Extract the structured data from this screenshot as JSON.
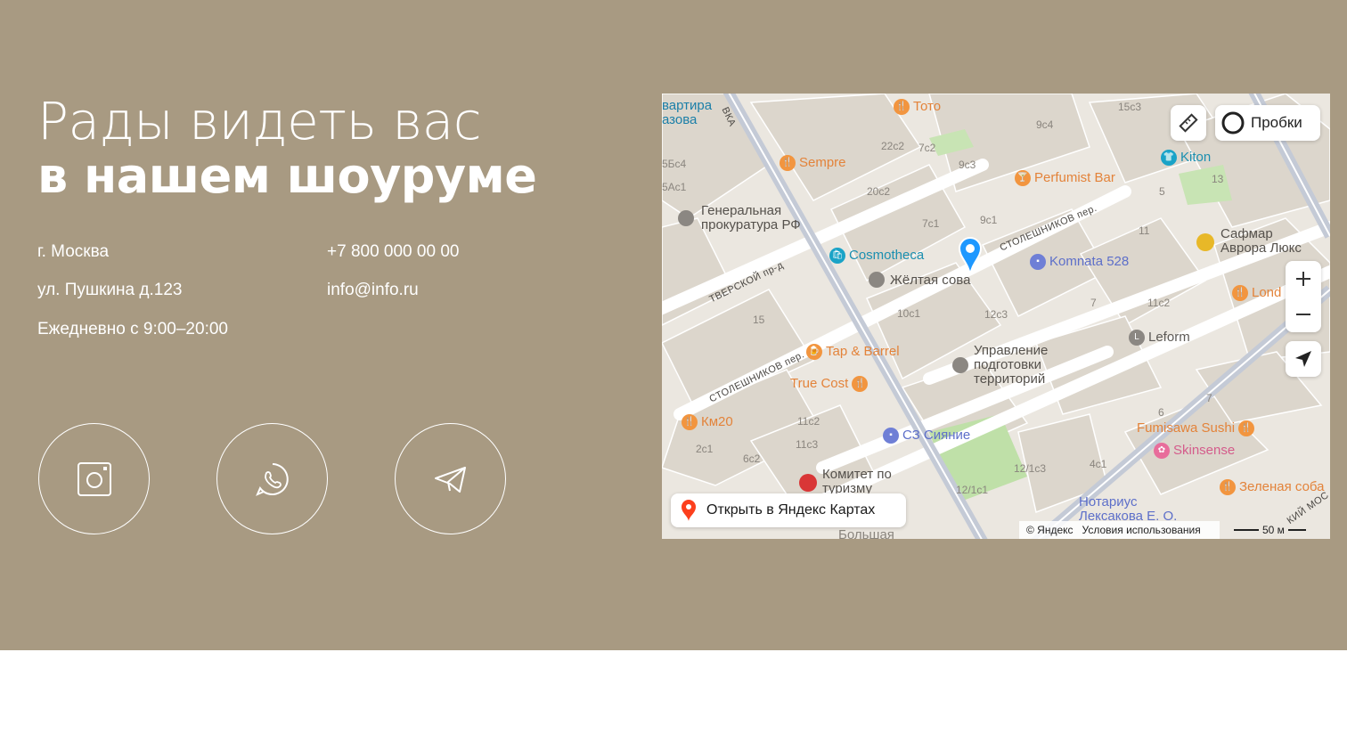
{
  "hero": {
    "title_line1": "Рады видеть вас",
    "title_line2": "в нашем шоуруме"
  },
  "contacts": {
    "city": "г. Москва",
    "street": "ул. Пушкина д.123",
    "hours": "Ежедневно с 9:00–20:00",
    "phone": "+7 800 000 00 00",
    "email": "info@info.ru"
  },
  "social": [
    {
      "name": "instagram",
      "icon": "instagram-icon"
    },
    {
      "name": "whatsapp",
      "icon": "whatsapp-icon"
    },
    {
      "name": "telegram",
      "icon": "telegram-icon"
    }
  ],
  "map": {
    "traffic_label": "Пробки",
    "open_label": "Открыть в Яндекс Картах",
    "copyright": "© Яндекс",
    "terms": "Условия использования",
    "scale": "50 м",
    "labels": {
      "kvartira": "вартира",
      "azova": "азова",
      "prokuratura1": "Генеральная",
      "prokuratura2": "прокуратура РФ",
      "zheltaya": "Жёлтая сова",
      "upravlenie1": "Управление",
      "upravlenie2": "подготовки",
      "upravlenie3": "территорий",
      "komitet1": "Комитет по",
      "komitet2": "туризму",
      "notarius1": "Нотариус",
      "notarius2": "Лексакова Е. О.",
      "safmar1": "Сафмар",
      "safmar2": "Аврора Люкс",
      "bolshaya": "Большая"
    },
    "pois": {
      "toto": "Тото",
      "sempre": "Sempre",
      "perfumist": "Perfumist Bar",
      "kiton": "Kiton",
      "cosmotheca": "Cosmotheca",
      "komnata": "Komnata 528",
      "tapbarrel": "Tap & Barrel",
      "truecost": "True Cost",
      "km20": "Км20",
      "siyanie": "СЗ Сияние",
      "leform": "Leform",
      "fumisawa": "Fumisawa Sushi",
      "skinsense": "Skinsense",
      "zelenaya": "Зеленая соба",
      "lond": "Lond"
    },
    "streets": {
      "stoleshnikov1": "СТОЛЕШНИКОВ пер.",
      "stoleshnikov2": "СТОЛЕШНИКОВ пер.",
      "tverskoy": "ТВЕРСКОЙ пр-д",
      "vka": "ВКА",
      "kiymos": "КИЙ МОС"
    },
    "numbers": {
      "n15c3": "15с3",
      "n9c4": "9с4",
      "n22c2": "22с2",
      "n7c2": "7с2",
      "n9c3": "9с3",
      "n5bc4": "5Бс4",
      "nac1": "5Ас1",
      "n20c2": "20с2",
      "n5": "5",
      "n13": "13",
      "n7c1": "7с1",
      "n9c1": "9с1",
      "n11": "11",
      "n15": "15",
      "n10c1": "10с1",
      "n12c3": "12с3",
      "n7": "7",
      "n11c2": "11с2",
      "n6": "6",
      "n7b": "7",
      "n11c2b": "11с2",
      "n11c3": "11с3",
      "n2c1": "2с1",
      "n6c2": "6с2",
      "n12_1c3": "12/1с3",
      "n12_1c1": "12/1с1",
      "n4c1": "4с1"
    }
  }
}
